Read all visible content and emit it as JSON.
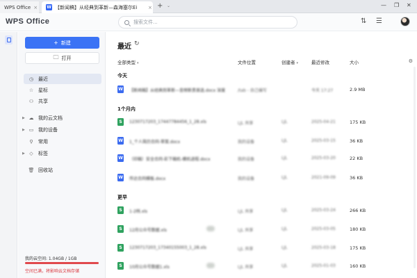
{
  "tabs": [
    {
      "label": "WPS Office",
      "close": "×"
    },
    {
      "label": "【新闻稿】从经典到革新—森海塞尔Ei",
      "icon": "W",
      "close": "×"
    }
  ],
  "tabbar": {
    "add": "+",
    "dropdown": "⌄"
  },
  "window": {
    "minimize": "—",
    "restore": "❐",
    "close": "✕"
  },
  "header": {
    "logo": "WPS Office",
    "search_placeholder": "搜索文件..."
  },
  "sidebar": {
    "new_label": "新建",
    "open_label": "打开",
    "nav": [
      {
        "label": "最近",
        "icon": "◷"
      },
      {
        "label": "星标",
        "icon": "☆"
      },
      {
        "label": "共享",
        "icon": "⚇"
      },
      {
        "label": "我的云文档",
        "icon": "☁"
      },
      {
        "label": "我的设备",
        "icon": "▭"
      },
      {
        "label": "常用",
        "icon": "⚲"
      },
      {
        "label": "标签",
        "icon": "◇"
      },
      {
        "label": "回收站",
        "icon": "🗑"
      }
    ],
    "quota_label": "我的云空间: 1.04GB / 1GB",
    "quota_used_fraction": 1.0,
    "quota_warning": "空间已满，将影响云文档存储"
  },
  "main": {
    "title": "最近",
    "columns": {
      "type": "全部类型",
      "location": "文件位置",
      "creator": "创建者",
      "modified": "最近修改",
      "size": "大小"
    },
    "sections": [
      {
        "label": "今天",
        "rows": [
          {
            "type": "W",
            "name": "【新闻稿】从经典到革新—音频新贵首选.docx 深度",
            "location": "/tab - 自己编写",
            "creator": "",
            "modified": "今天 17:27",
            "size": "2.9 MB"
          }
        ]
      },
      {
        "label": "1个月内",
        "rows": [
          {
            "type": "S",
            "name": "1230717203_17447784456_1_28.xls",
            "location": "LJL 共享",
            "creator": "LJL",
            "modified": "2025-04-21",
            "size": "175 KB"
          },
          {
            "type": "W",
            "name": "1_个人简历合同-草案.docx",
            "location": "我的设备",
            "creator": "LJL",
            "modified": "2025-03-15",
            "size": "36 KB"
          },
          {
            "type": "W",
            "name": "（印稿）安全合同-彩下稿机-模机进程.docx",
            "location": "我的设备",
            "creator": "LJL",
            "modified": "2025-03-20",
            "size": "22 KB"
          },
          {
            "type": "W",
            "name": "传达合同模板.docx",
            "location": "我的设备",
            "creator": "LJL",
            "modified": "2021-09-09",
            "size": "36 KB"
          }
        ]
      },
      {
        "label": "更早",
        "rows": [
          {
            "type": "S",
            "name": "1-2档.xls",
            "location": "LJL 共享",
            "creator": "LJL",
            "modified": "2025-03-24",
            "size": "266 KB"
          },
          {
            "type": "S",
            "name": "12月公众号数据.xls",
            "location": "LJL 共享",
            "creator": "LJL",
            "modified": "2025-03-05",
            "size": "180 KB"
          },
          {
            "type": "S",
            "name": "1230717203_17340155003_1_28.xls",
            "location": "LJL 共享",
            "creator": "LJL",
            "modified": "2025-03-18",
            "size": "175 KB"
          },
          {
            "type": "S",
            "name": "10月公众号数据1.xls",
            "location": "LJL 共享",
            "creator": "LJL",
            "modified": "2025-01-03",
            "size": "160 KB"
          }
        ]
      }
    ]
  },
  "colors": {
    "accent": "#3b73f5",
    "word": "#3b6bf0",
    "sheet": "#2fa25f",
    "warning": "#d9363e"
  }
}
